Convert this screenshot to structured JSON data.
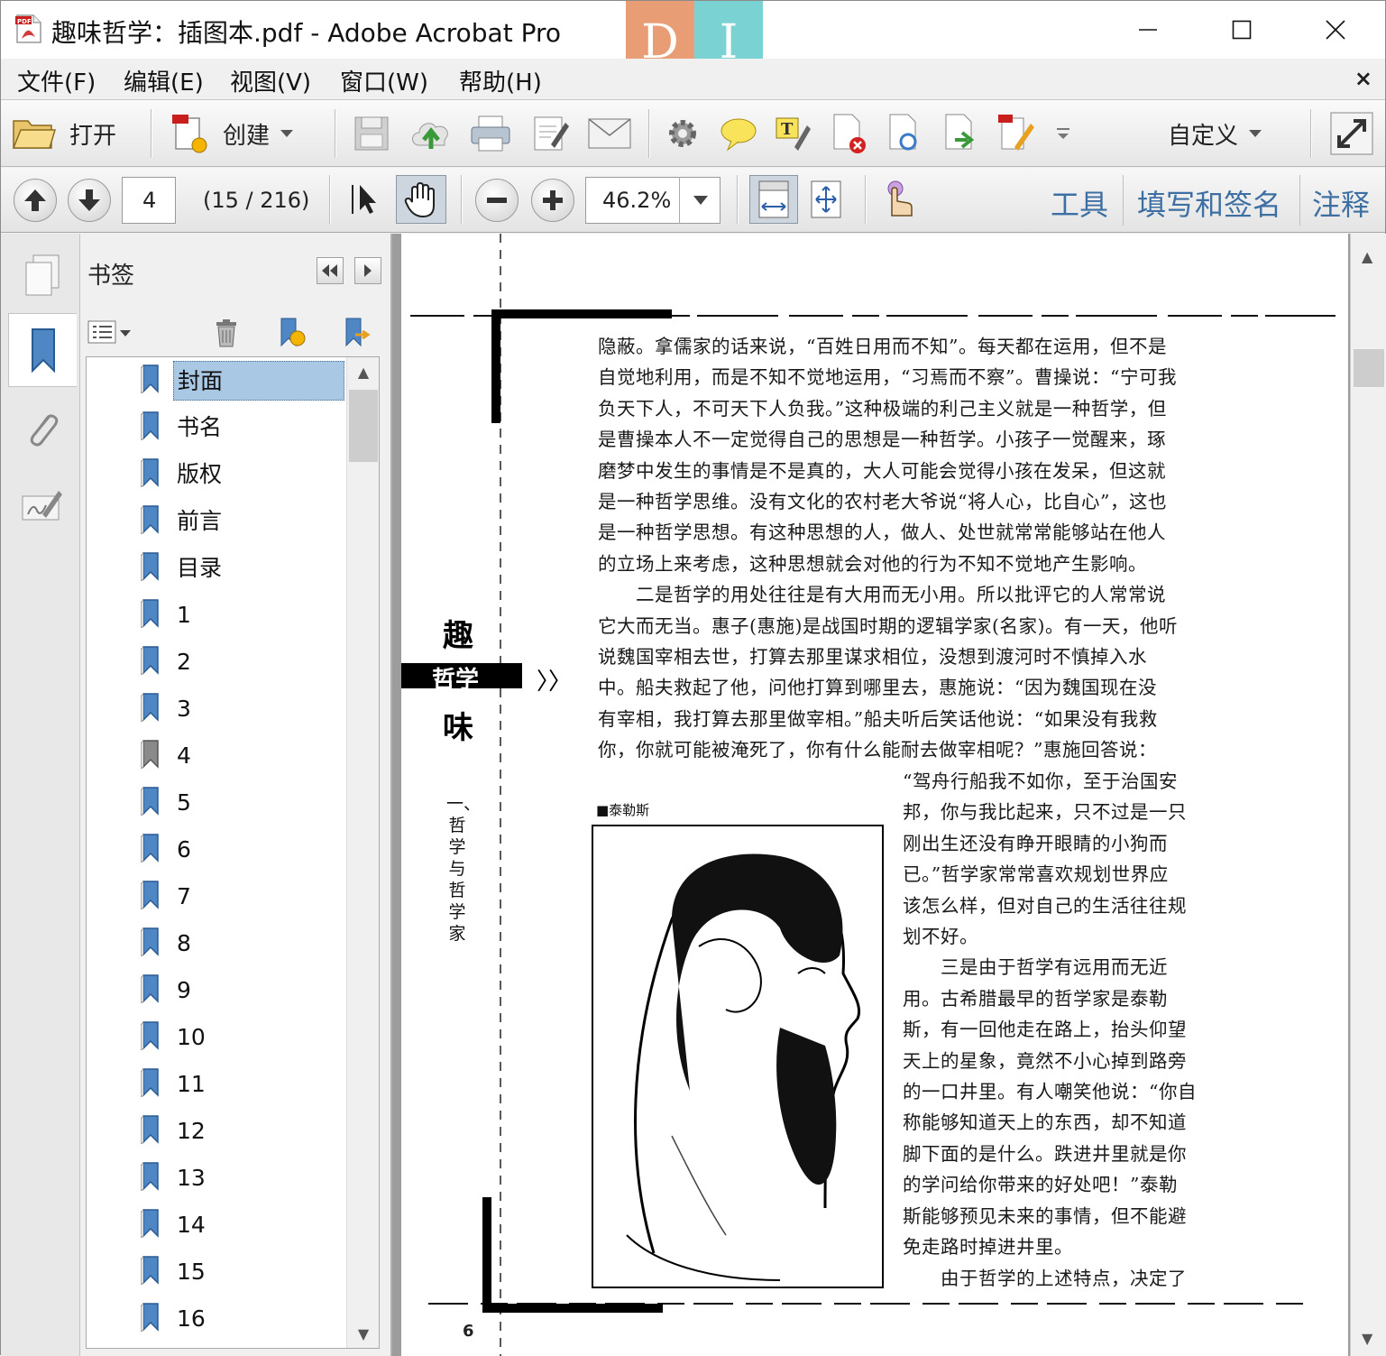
{
  "window": {
    "title": "趣味哲学：插图本.pdf - Adobe Acrobat Pro",
    "badge_left": "D",
    "badge_right": "I",
    "badge_left_color": "#e8956a",
    "badge_right_color": "#6fcfcf"
  },
  "menu": [
    "文件(F)",
    "编辑(E)",
    "视图(V)",
    "窗口(W)",
    "帮助(H)"
  ],
  "menu_close": "×",
  "toolbar": {
    "open_label": "打开",
    "create_label": "创建",
    "customize_label": "自定义"
  },
  "nav": {
    "current_page": "4",
    "page_count": "(15 / 216)",
    "zoom": "46.2%",
    "tools_label": "工具",
    "sign_label": "填写和签名",
    "comment_label": "注释"
  },
  "bookmarks": {
    "title": "书签",
    "items": [
      "封面",
      "书名",
      "版权",
      "前言",
      "目录",
      "1",
      "2",
      "3",
      "4",
      "5",
      "6",
      "7",
      "8",
      "9",
      "10",
      "11",
      "12",
      "13",
      "14",
      "15",
      "16"
    ],
    "selected": "封面",
    "current_marker": "4"
  },
  "colors": {
    "accent": "#3d6fa3",
    "selection": "#a8c8e4",
    "bookmark_icon": "#4f87c5"
  },
  "document": {
    "side_title_top": "趣",
    "side_title_mid": "哲学",
    "side_title_bottom": "味",
    "side_arrow": "〉〉",
    "chapter_vertical": "一、哲学与哲学家",
    "caption": "■泰勒斯",
    "page_number": "6",
    "para_top": [
      "隐蔽。拿儒家的话来说，“百姓日用而不知”。每天都在运用，但不是",
      "自觉地利用，而是不知不觉地运用，“习焉而不察”。曹操说：“宁可我",
      "负天下人，不可天下人负我。”这种极端的利己主义就是一种哲学，但",
      "是曹操本人不一定觉得自己的思想是一种哲学。小孩子一觉醒来，琢",
      "磨梦中发生的事情是不是真的，大人可能会觉得小孩在发呆，但这就",
      "是一种哲学思维。没有文化的农村老大爷说“将人心，比自心”，这也",
      "是一种哲学思想。有这种思想的人，做人、处世就常常能够站在他人",
      "的立场上来考虑，这种思想就会对他的行为不知不觉地产生影响。",
      "　　二是哲学的用处往往是有大用而无小用。所以批评它的人常常说",
      "它大而无当。惠子(惠施)是战国时期的逻辑学家(名家)。有一天，他听",
      "说魏国宰相去世，打算去那里谋求相位，没想到渡河时不慎掉入水",
      "中。船夫救起了他，问他打算到哪里去，惠施说：“因为魏国现在没",
      "有宰相，我打算去那里做宰相。”船夫听后笑话他说：“如果没有我救",
      "你，你就可能被淹死了，你有什么能耐去做宰相呢？”惠施回答说："
    ],
    "para_right": [
      "“驾舟行船我不如你，至于治国安",
      "邦，你与我比起来，只不过是一只",
      "刚出生还没有睁开眼睛的小狗而",
      "已。”哲学家常常喜欢规划世界应",
      "该怎么样，但对自己的生活往往规",
      "划不好。",
      "　　三是由于哲学有远用而无近",
      "用。古希腊最早的哲学家是泰勒",
      "斯，有一回他走在路上，抬头仰望",
      "天上的星象，竟然不小心掉到路旁",
      "的一口井里。有人嘲笑他说：“你自",
      "称能够知道天上的东西，却不知道",
      "脚下面的是什么。跌进井里就是你",
      "的学问给你带来的好处吧！”泰勒",
      "斯能够预见未来的事情，但不能避",
      "免走路时掉进井里。",
      "　　由于哲学的上述特点，决定了"
    ]
  }
}
